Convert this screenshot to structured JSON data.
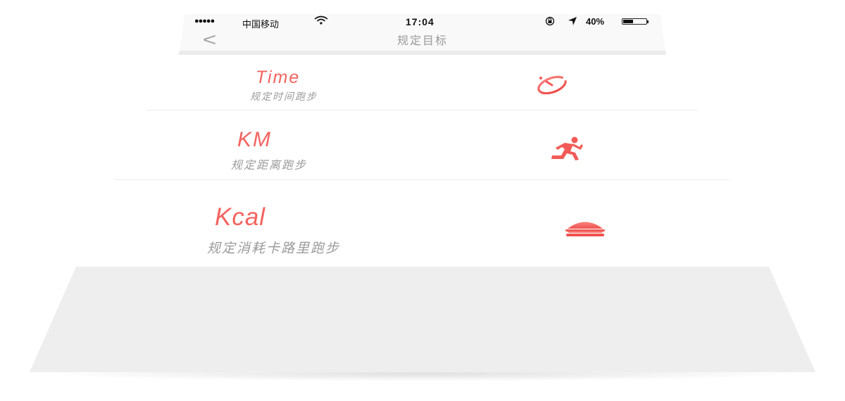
{
  "status_bar": {
    "signal": "●●●●●",
    "carrier": "中国移动",
    "wifi_icon": "wifi-icon",
    "time": "17:04",
    "lock_icon": "rotation-lock-icon",
    "location_icon": "location-arrow-icon",
    "battery_percent": "40%",
    "battery_level": 0.4
  },
  "nav": {
    "back_icon": "chevron-left-icon",
    "back_glyph": "<",
    "title": "规定目标"
  },
  "goals": [
    {
      "title": "Time",
      "subtitle": "规定时间跑步",
      "icon": "stopwatch-icon"
    },
    {
      "title": "KM",
      "subtitle": "规定距离跑步",
      "icon": "runner-icon"
    },
    {
      "title": "Kcal",
      "subtitle": "规定消耗卡路里跑步",
      "icon": "burger-icon"
    }
  ],
  "colors": {
    "accent": "#f4635f",
    "subtitle": "#9b9b9b",
    "nav_title": "#9a9a9a",
    "background": "#eeeeee"
  }
}
